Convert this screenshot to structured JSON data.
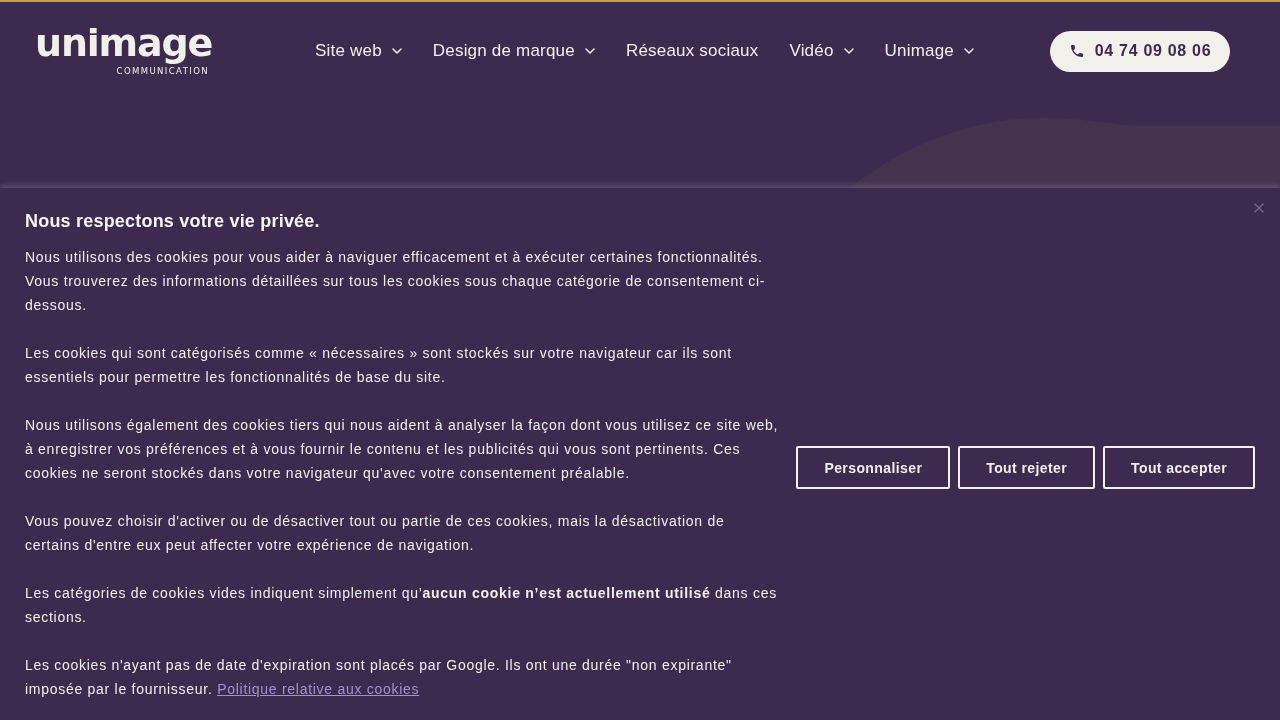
{
  "header": {
    "logo": {
      "wordmark": "unimage",
      "tagline": "COMMUNICATION"
    },
    "nav": [
      {
        "label": "Site web",
        "has_submenu": true
      },
      {
        "label": "Design de marque",
        "has_submenu": true
      },
      {
        "label": "Réseaux sociaux",
        "has_submenu": false
      },
      {
        "label": "Vidéo",
        "has_submenu": true
      },
      {
        "label": "Unimage",
        "has_submenu": true
      }
    ],
    "phone_button": {
      "label": "04 74 09 08 06"
    }
  },
  "cookie_banner": {
    "title": "Nous respectons votre vie privée.",
    "paragraphs": [
      {
        "text": "Nous utilisons des cookies pour vous aider à naviguer efficacement et à exécuter certaines fonctionnalités. Vous trouverez des informations détaillées sur tous les cookies sous chaque catégorie de consentement ci-dessous."
      },
      {
        "text": "Les cookies qui sont catégorisés comme « nécessaires » sont stockés sur votre navigateur car ils sont essentiels pour permettre les fonctionnalités de base du site."
      },
      {
        "text": "Nous utilisons également des cookies tiers qui nous aident à analyser la façon dont vous utilisez ce site web, à enregistrer vos préférences et à vous fournir le contenu et les publicités qui vous sont pertinents. Ces cookies ne seront stockés dans votre navigateur qu'avec votre consentement préalable."
      },
      {
        "text": "Vous pouvez choisir d'activer ou de désactiver tout ou partie de ces cookies, mais la désactivation de certains d'entre eux peut affecter votre expérience de navigation."
      },
      {
        "text": "Les catégories de cookies vides indiquent simplement qu’**aucun cookie n’est actuellement utilisé** dans ces sections."
      },
      {
        "text": "Les cookies n'ayant pas de date d'expiration sont placés par Google. Ils ont une durée \"non expirante\" imposée par le fournisseur.",
        "link": "Politique relative aux cookies"
      }
    ],
    "buttons": [
      {
        "label": "Personnaliser"
      },
      {
        "label": "Tout rejeter"
      },
      {
        "label": "Tout accepter"
      }
    ]
  }
}
